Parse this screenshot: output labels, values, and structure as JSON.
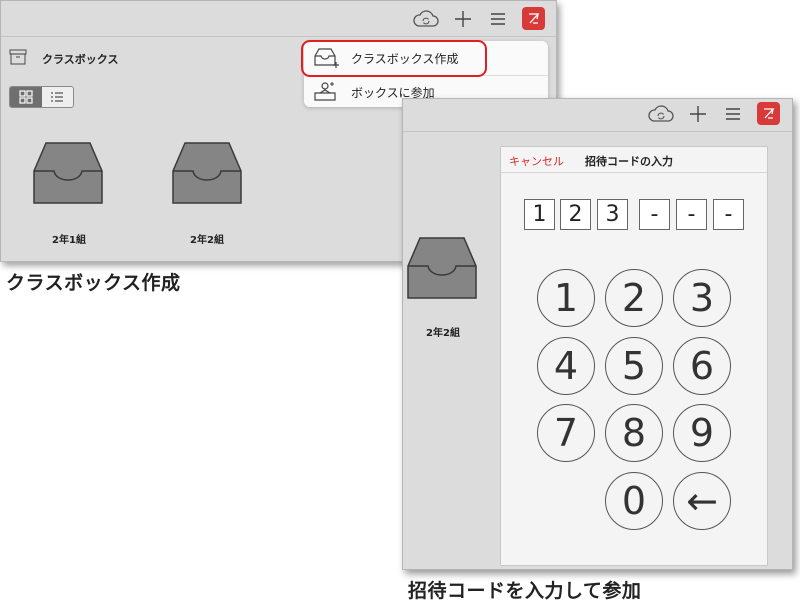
{
  "panel1": {
    "title": "クラスボックス",
    "menu": [
      {
        "label": "クラスボックス作成",
        "icon": "new-classbox-icon"
      },
      {
        "label": "ボックスに参加",
        "icon": "join-box-icon"
      }
    ],
    "boxes": [
      {
        "label": "2年1組",
        "icon": "tray-icon"
      },
      {
        "label": "2年2組",
        "icon": "tray-icon"
      }
    ],
    "accent": "#d83a3a",
    "highlight_color": "#e02020"
  },
  "captions": {
    "create": "クラスボックス作成",
    "join": "招待コードを入力して参加"
  },
  "panel2": {
    "box_label": "2年2組",
    "sheet": {
      "cancel_label": "キャンセル",
      "title": "招待コードの入力",
      "code_digits": [
        "1",
        "2",
        "3",
        "-",
        "-",
        "-"
      ],
      "keys": [
        "1",
        "2",
        "3",
        "4",
        "5",
        "6",
        "7",
        "8",
        "9",
        "0",
        "←"
      ]
    }
  }
}
